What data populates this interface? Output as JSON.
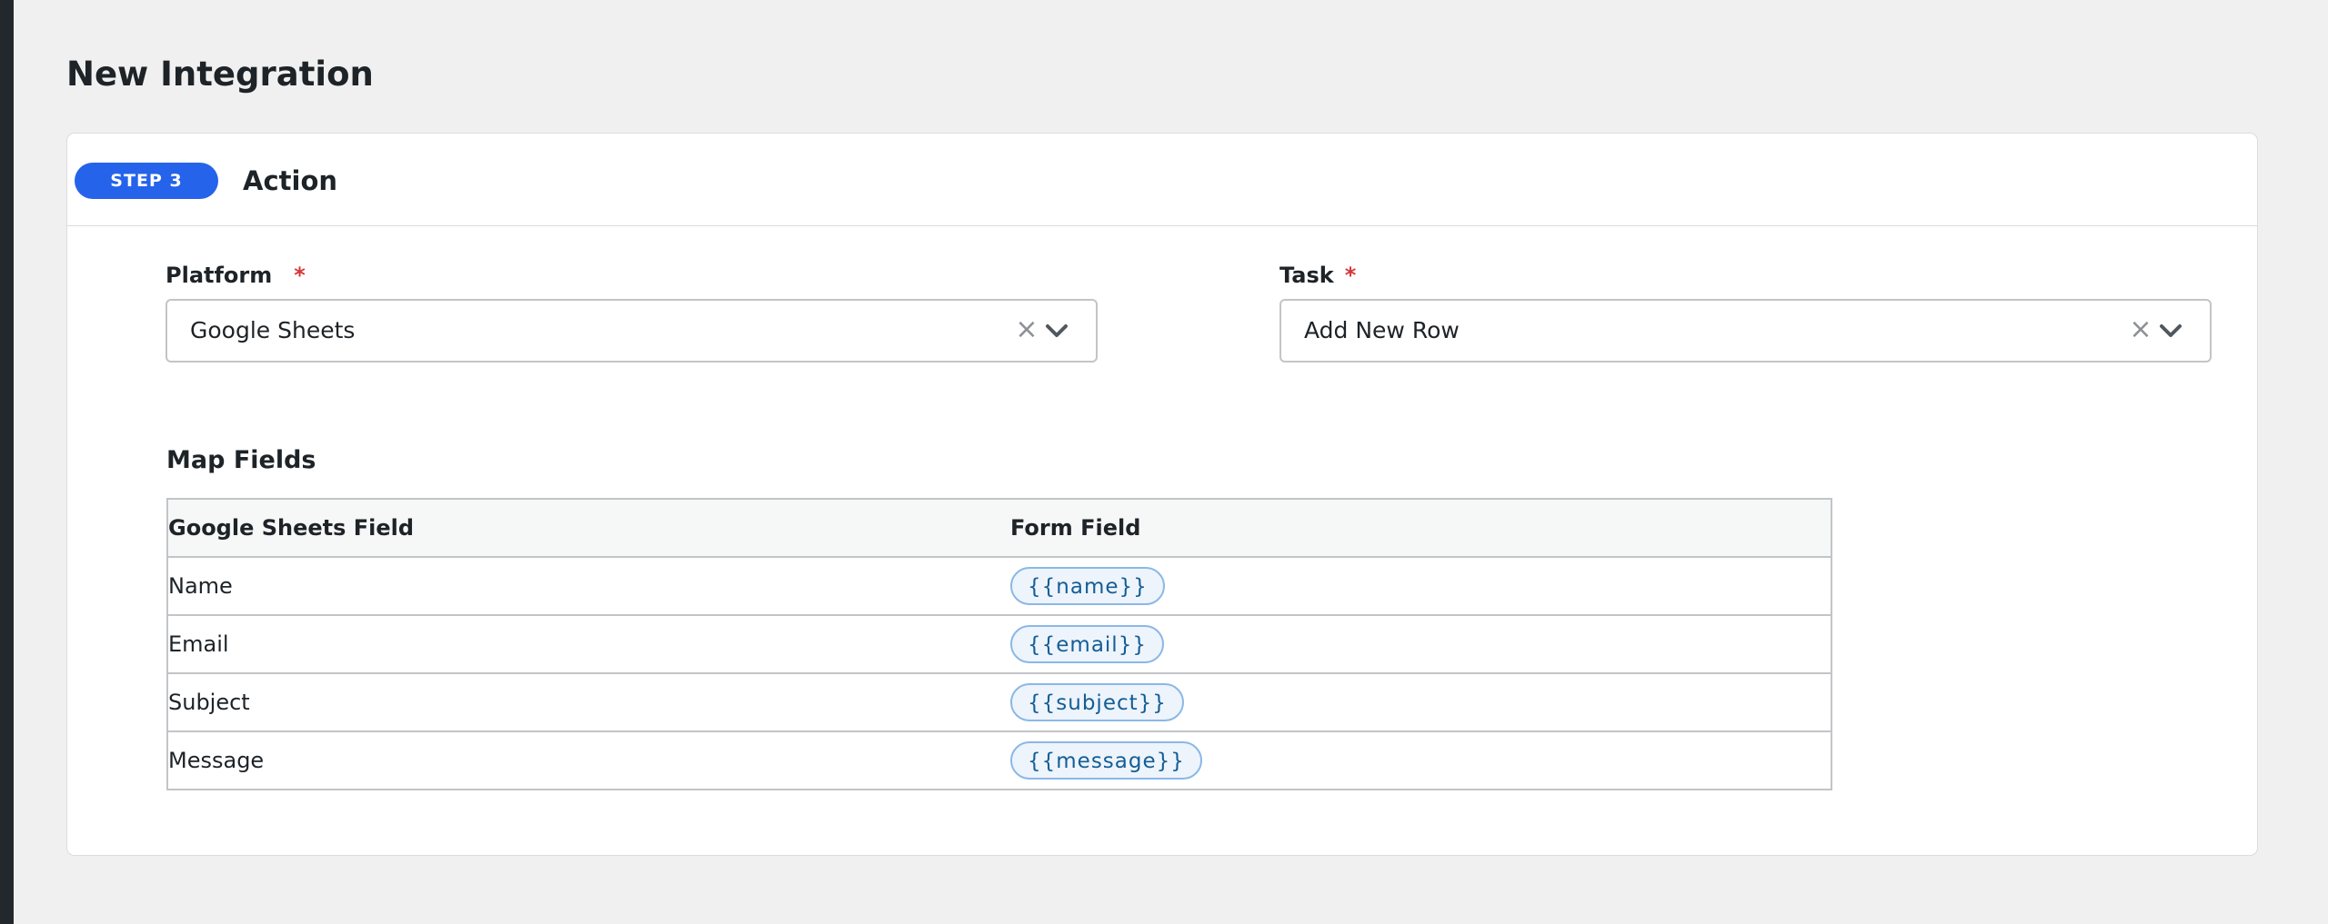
{
  "page": {
    "title": "New Integration"
  },
  "step": {
    "badge": "STEP 3",
    "title": "Action"
  },
  "platform": {
    "label": "Platform",
    "required_mark": "*",
    "value": "Google Sheets",
    "clear_glyph": "×"
  },
  "task": {
    "label": "Task",
    "required_mark": "*",
    "value": "Add New Row",
    "clear_glyph": "×"
  },
  "map_fields": {
    "title": "Map Fields",
    "columns": [
      "Google Sheets Field",
      "Form Field"
    ],
    "rows": [
      {
        "field": "Name",
        "token": "{{name}}"
      },
      {
        "field": "Email",
        "token": "{{email}}"
      },
      {
        "field": "Subject",
        "token": "{{subject}}"
      },
      {
        "field": "Message",
        "token": "{{message}}"
      }
    ]
  },
  "colors": {
    "accent": "#2563eb",
    "required": "#d63638",
    "token_text": "#135e96",
    "token_border": "#8ab8e6",
    "token_bg": "#eef4fb",
    "page_bg": "#f0f0f1"
  },
  "icons": {
    "clear": "close-icon",
    "dropdown": "chevron-down-icon"
  }
}
